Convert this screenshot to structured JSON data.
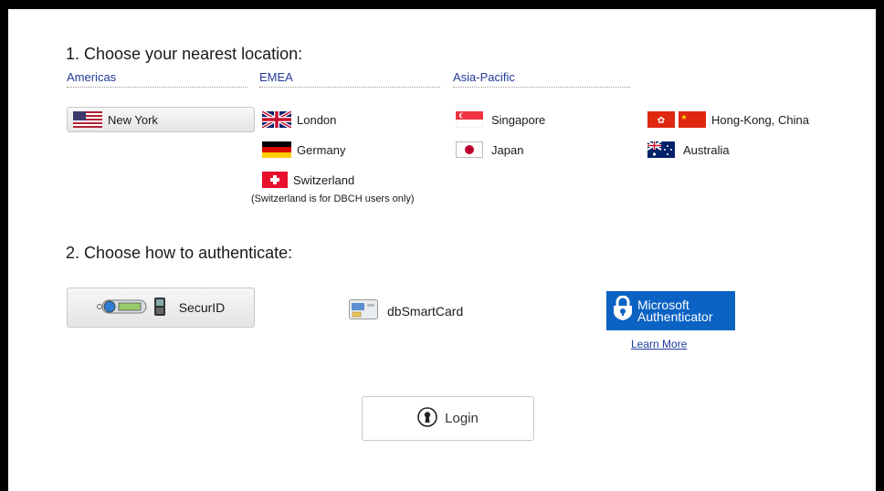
{
  "step1_title": "1. Choose your nearest location:",
  "regions": {
    "americas": "Americas",
    "emea": "EMEA",
    "asia_pacific": "Asia-Pacific"
  },
  "locations": {
    "new_york": "New York",
    "london": "London",
    "germany": "Germany",
    "switzerland": "Switzerland",
    "singapore": "Singapore",
    "japan": "Japan",
    "hong_kong": "Hong-Kong, China",
    "australia": "Australia"
  },
  "switzerland_note": "(Switzerland is for DBCH users only)",
  "step2_title": "2. Choose how to authenticate:",
  "auth": {
    "securid": "SecurID",
    "smartcard": "dbSmartCard",
    "ms_line1": "Microsoft",
    "ms_line2": "Authenticator",
    "learn_more": "Learn More"
  },
  "login_label": "Login",
  "selected_location": "New York",
  "colors": {
    "region_link": "#23399a",
    "ms_blue": "#0a62c3"
  }
}
